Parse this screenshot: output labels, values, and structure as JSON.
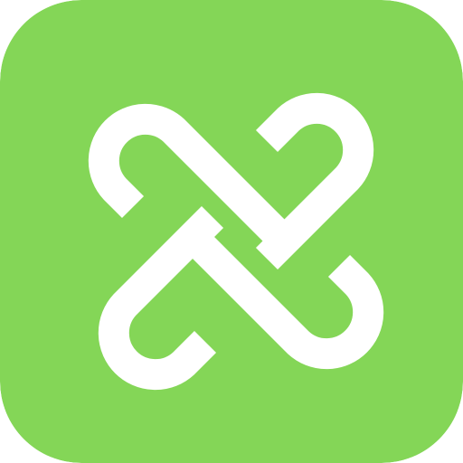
{
  "app_icon": {
    "icon": "interlaced-knot-icon",
    "background_color": "#84D657",
    "glyph_color": "#FFFFFF"
  }
}
